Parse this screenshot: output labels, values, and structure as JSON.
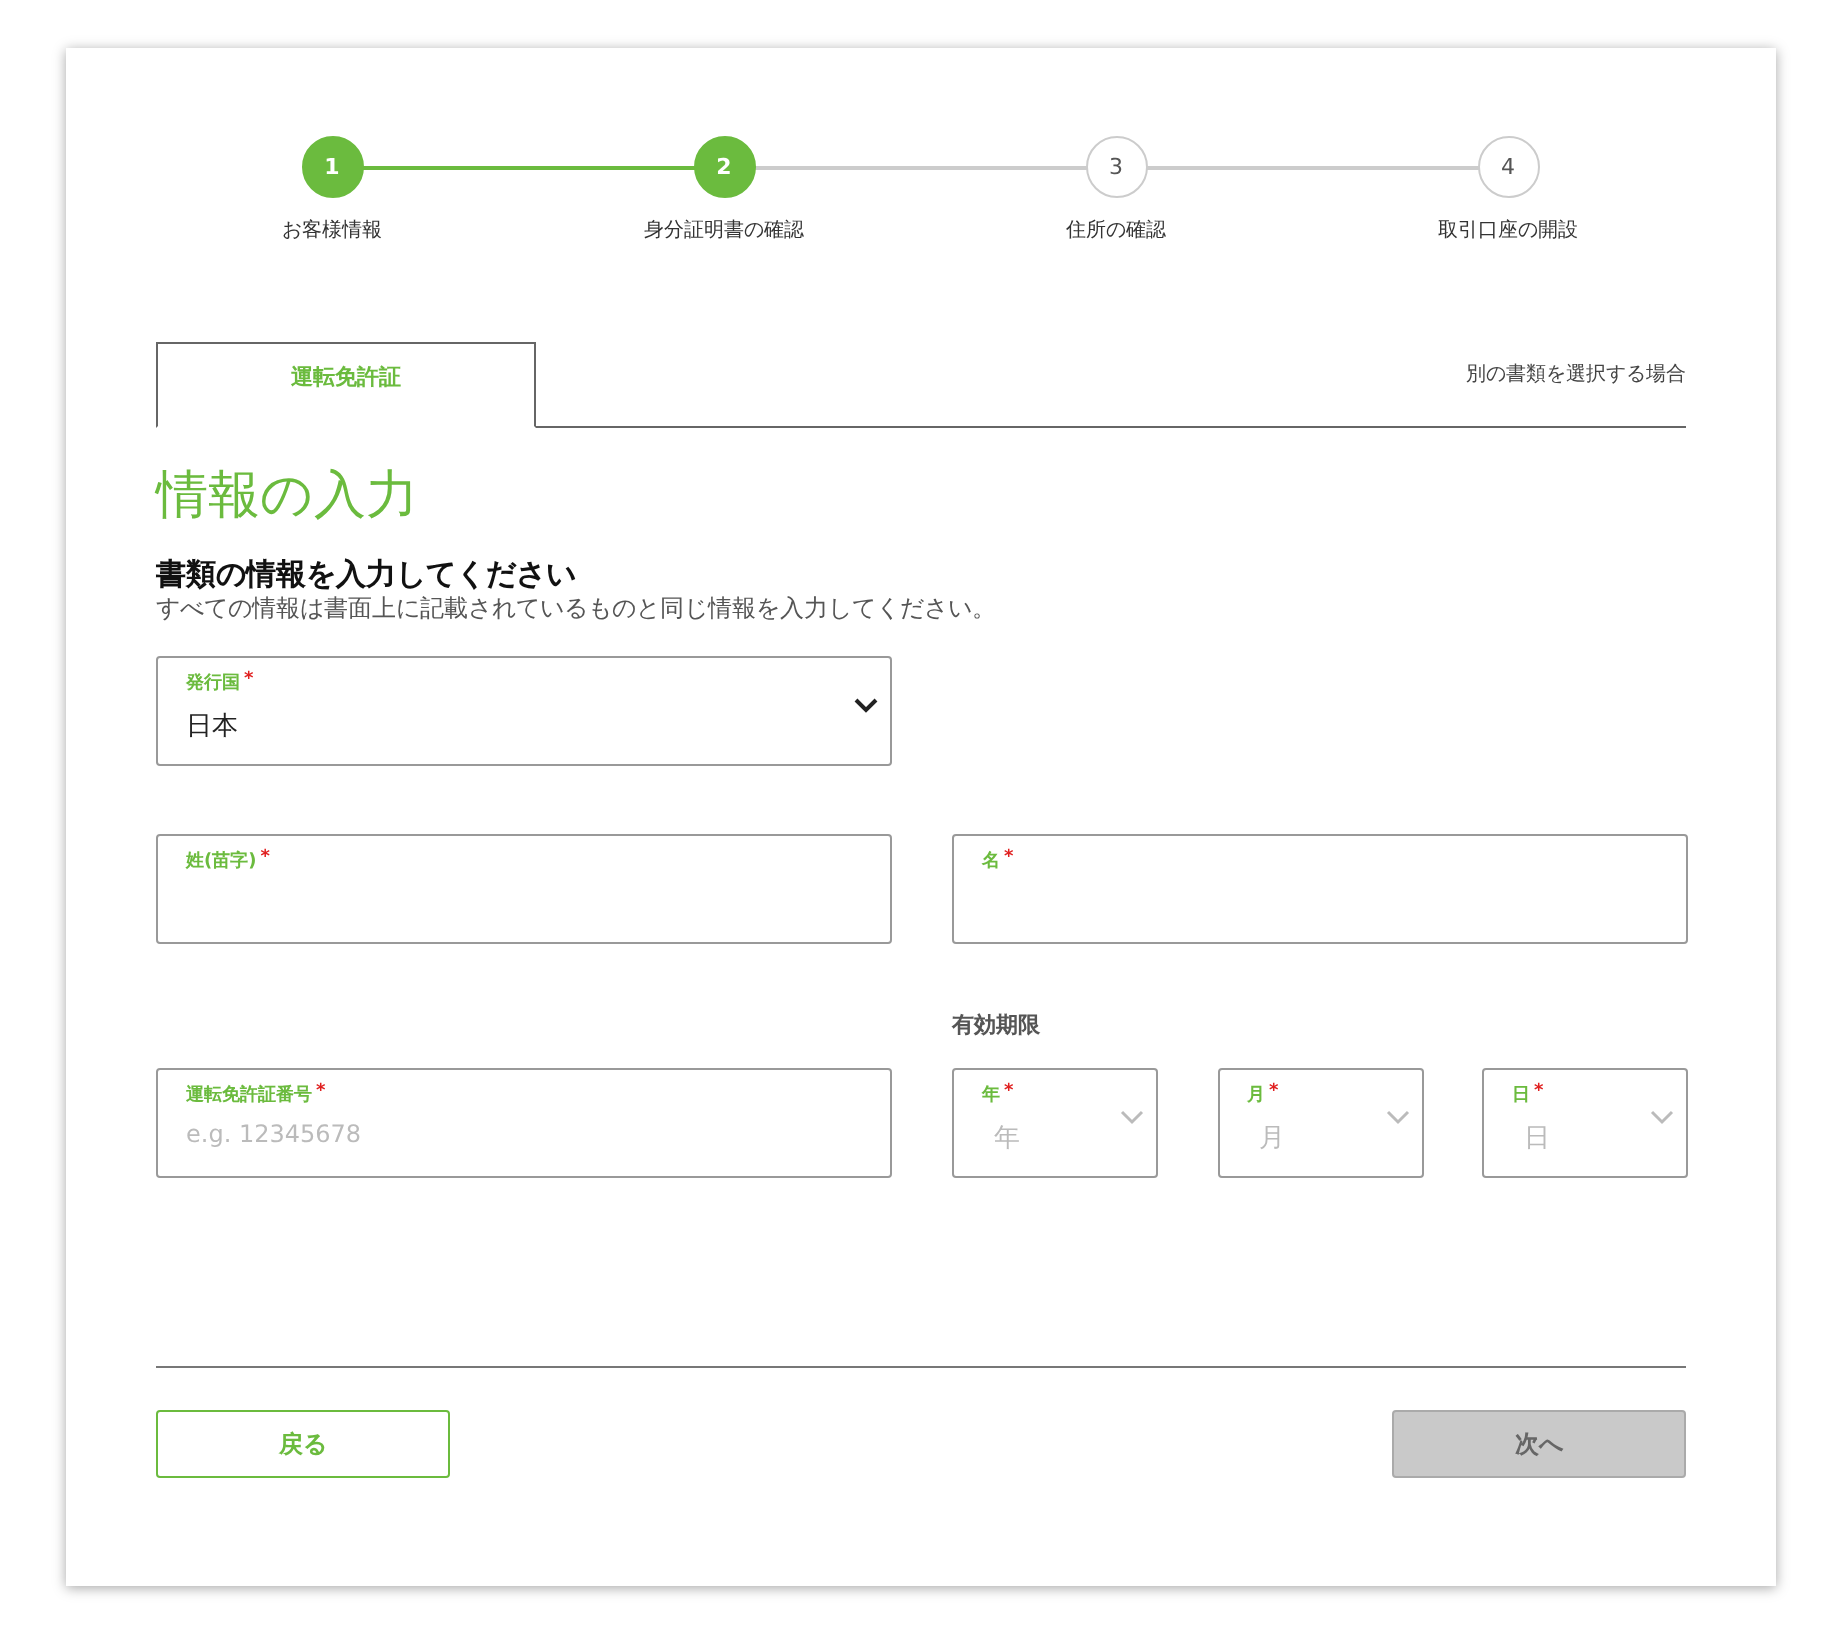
{
  "steps": [
    {
      "number": "1",
      "label": "お客様情報",
      "done": true
    },
    {
      "number": "2",
      "label": "身分証明書の確認",
      "done": true
    },
    {
      "number": "3",
      "label": "住所の確認",
      "done": false
    },
    {
      "number": "4",
      "label": "取引口座の開設",
      "done": false
    }
  ],
  "tabs": [
    {
      "label": "運転免許証",
      "selected": true
    }
  ],
  "other_document_link": "別の書類を選択する場合",
  "heading": "情報の入力",
  "subheading": "書類の情報を入力してください",
  "description": "すべての情報は書面上に記載されているものと同じ情報を入力してください。",
  "country": {
    "label": "発行国",
    "required_mark": "*",
    "value": "日本"
  },
  "last_name": {
    "label": "姓(苗字)",
    "required_mark": "*"
  },
  "first_name": {
    "label": "名",
    "required_mark": "*"
  },
  "expiry_label": "有効期限",
  "license_number": {
    "label": "運転免許証番号",
    "required_mark": "*",
    "placeholder": "e.g. 12345678"
  },
  "expiry_fields": [
    {
      "label": "年",
      "required_mark": "*",
      "placeholder": "年"
    },
    {
      "label": "月",
      "required_mark": "*",
      "placeholder": "月"
    },
    {
      "label": "日",
      "required_mark": "*",
      "placeholder": "日"
    }
  ],
  "back_button": {
    "label": "戻る",
    "disabled": false
  },
  "next_button": {
    "label": "次へ",
    "disabled": true
  }
}
